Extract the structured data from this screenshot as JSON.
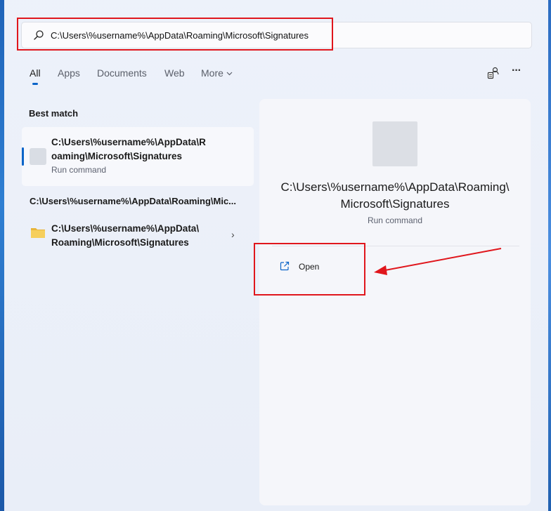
{
  "search": {
    "value": "C:\\Users\\%username%\\AppData\\Roaming\\Microsoft\\Signatures",
    "icon": "search-icon"
  },
  "tabs": [
    {
      "label": "All",
      "active": true
    },
    {
      "label": "Apps",
      "active": false
    },
    {
      "label": "Documents",
      "active": false
    },
    {
      "label": "Web",
      "active": false
    },
    {
      "label": "More",
      "active": false
    }
  ],
  "toolbar": {
    "account_icon": "account-switch-icon",
    "more_icon": "more-options-icon",
    "more_glyph": "···"
  },
  "best_match": {
    "heading": "Best match",
    "title_line1": "C:\\Users\\%username%\\AppData\\R",
    "title_line2": "oaming\\Microsoft\\Signatures",
    "subtitle": "Run command"
  },
  "folder_section": {
    "heading": "C:\\Users\\%username%\\AppData\\Roaming\\Mic...",
    "item_line1": "C:\\Users\\%username%\\AppData\\",
    "item_line2": "Roaming\\Microsoft\\Signatures",
    "chevron": "›"
  },
  "preview": {
    "title_line1": "C:\\Users\\%username%\\AppData\\Roaming\\",
    "title_line2": "Microsoft\\Signatures",
    "subtitle": "Run command",
    "open_label": "Open"
  },
  "colors": {
    "accent": "#0a64c8",
    "annotation": "#e0161c"
  }
}
